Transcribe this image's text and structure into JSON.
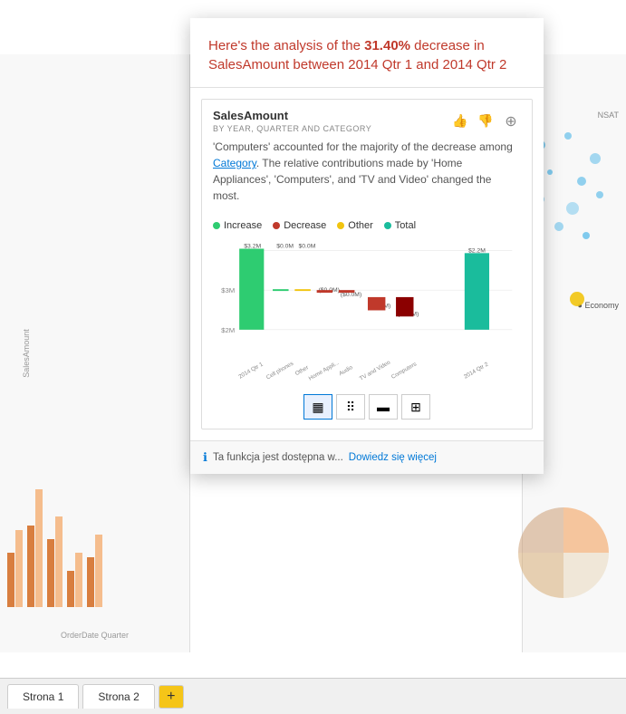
{
  "header": {
    "title": "Here's the analysis of the 31.40% decrease in SalesAmount between 2014 Qtr 1 and 2014 Qtr 2",
    "title_plain": "Here's the analysis of the ",
    "pct": "31.40%",
    "title_suffix": " decrease in SalesAmount between 2014 Qtr 1 and 2014 Qtr 2"
  },
  "inner_card": {
    "title": "SalesAmount",
    "subtitle": "BY YEAR, QUARTER AND CATEGORY",
    "description": "'Computers' accounted for the majority of the decrease among Category. The relative contributions made by 'Home Appliances', 'Computers', and 'TV and Video' changed the most.",
    "category_link": "Category"
  },
  "legend": [
    {
      "label": "Increase",
      "color": "#2ecc71"
    },
    {
      "label": "Decrease",
      "color": "#c0392b"
    },
    {
      "label": "Other",
      "color": "#f1c40f"
    },
    {
      "label": "Total",
      "color": "#1abc9c"
    }
  ],
  "chart": {
    "y_labels": [
      "$3M",
      "$2M"
    ],
    "bar_labels": [
      "2014 Qtr 1",
      "Cell phones",
      "Other",
      "Home Appli...",
      "Audio",
      "TV and Video",
      "Computers",
      "2014 Qtr 2"
    ],
    "value_labels": [
      "$3.2M",
      "$0.0M",
      "$0.0M",
      "($0.0M)",
      "($0.0M)",
      "($0.4M)",
      "($0.6M)",
      "$2.2M"
    ],
    "bar_values": [
      3.2,
      0.0,
      0.0,
      -0.05,
      -0.05,
      -0.4,
      -0.6,
      2.2
    ]
  },
  "chart_type_buttons": [
    {
      "label": "▦",
      "active": true
    },
    {
      "label": "⠿",
      "active": false
    },
    {
      "label": "▬",
      "active": false
    },
    {
      "label": "⊞",
      "active": false
    }
  ],
  "info_bar": {
    "text": "Ta funkcja jest dostępna w...",
    "link_text": "Dowiedz się więcej"
  },
  "tabs": [
    {
      "label": "Strona 1",
      "active": false
    },
    {
      "label": "Strona 2",
      "active": true
    },
    {
      "label": "+",
      "type": "add"
    }
  ],
  "actions": [
    {
      "name": "thumbs-up",
      "icon": "👍"
    },
    {
      "name": "thumbs-down",
      "icon": "👎"
    },
    {
      "name": "add",
      "icon": "➕"
    }
  ],
  "background": {
    "left_label": "SalesAmount",
    "bottom_label": "OrderDate Quarter"
  }
}
